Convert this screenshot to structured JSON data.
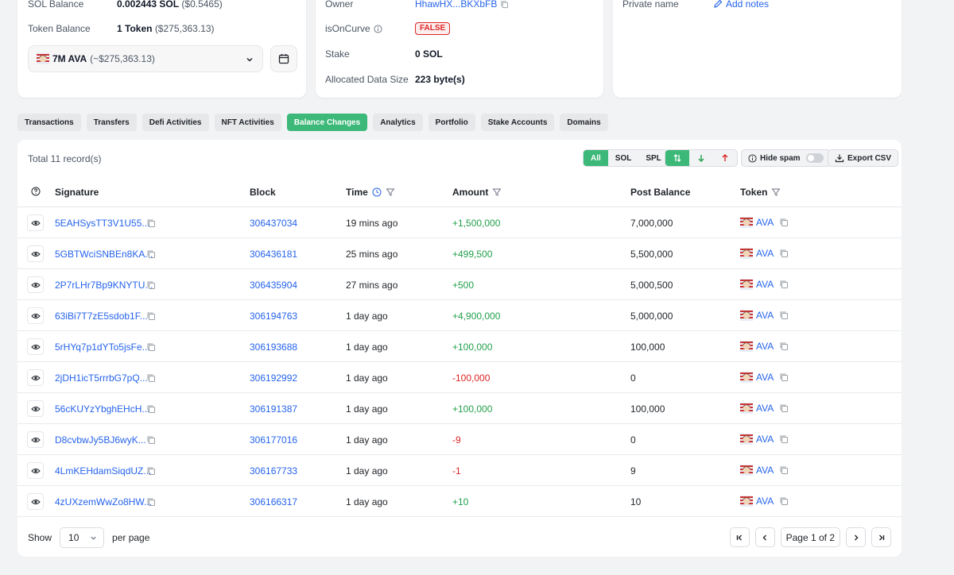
{
  "summary": {
    "sol_balance_label": "SOL Balance",
    "sol_balance_value": "0.002443 SOL",
    "sol_balance_usd": "($0.5465)",
    "token_balance_label": "Token Balance",
    "token_balance_value": "1 Token",
    "token_balance_usd": "($275,363.13)",
    "token_select_amount": "7M AVA",
    "token_select_usd": "(~$275,363.13)"
  },
  "account": {
    "owner_label": "Owner",
    "owner_value": "HhawHX...BKXbFB",
    "is_on_curve_label": "isOnCurve",
    "is_on_curve_value": "FALSE",
    "stake_label": "Stake",
    "stake_value": "0 SOL",
    "alloc_label": "Allocated Data Size",
    "alloc_value": "223 byte(s)"
  },
  "notes": {
    "private_name_label": "Private name",
    "add_notes": "Add notes"
  },
  "tabs": [
    {
      "label": "Transactions"
    },
    {
      "label": "Transfers"
    },
    {
      "label": "Defi Activities"
    },
    {
      "label": "NFT Activities"
    },
    {
      "label": "Balance Changes"
    },
    {
      "label": "Analytics"
    },
    {
      "label": "Portfolio"
    },
    {
      "label": "Stake Accounts"
    },
    {
      "label": "Domains"
    }
  ],
  "active_tab": "Balance Changes",
  "table": {
    "total": "Total 11 record(s)",
    "filters": {
      "all": "All",
      "sol": "SOL",
      "spl": "SPL"
    },
    "hide_spam": "Hide spam",
    "export": "Export CSV",
    "columns": {
      "signature": "Signature",
      "block": "Block",
      "time": "Time",
      "amount": "Amount",
      "post_balance": "Post Balance",
      "token": "Token"
    },
    "rows": [
      {
        "sig": "5EAHSysTT3V1U55...",
        "block": "306437034",
        "time": "19 mins ago",
        "amount": "+1,500,000",
        "balance": "7,000,000",
        "token": "AVA"
      },
      {
        "sig": "5GBTWciSNBEn8KA...",
        "block": "306436181",
        "time": "25 mins ago",
        "amount": "+499,500",
        "balance": "5,500,000",
        "token": "AVA"
      },
      {
        "sig": "2P7rLHr7Bp9KNYTU...",
        "block": "306435904",
        "time": "27 mins ago",
        "amount": "+500",
        "balance": "5,000,500",
        "token": "AVA"
      },
      {
        "sig": "63iBi7T7zE5sdob1F...",
        "block": "306194763",
        "time": "1 day ago",
        "amount": "+4,900,000",
        "balance": "5,000,000",
        "token": "AVA"
      },
      {
        "sig": "5rHYq7p1dYTo5jsFe...",
        "block": "306193688",
        "time": "1 day ago",
        "amount": "+100,000",
        "balance": "100,000",
        "token": "AVA"
      },
      {
        "sig": "2jDH1icT5rrrbG7pQ...",
        "block": "306192992",
        "time": "1 day ago",
        "amount": "-100,000",
        "balance": "0",
        "token": "AVA"
      },
      {
        "sig": "56cKUYzYbghEHcH...",
        "block": "306191387",
        "time": "1 day ago",
        "amount": "+100,000",
        "balance": "100,000",
        "token": "AVA"
      },
      {
        "sig": "D8cvbwJy5BJ6wyK...",
        "block": "306177016",
        "time": "1 day ago",
        "amount": "-9",
        "balance": "0",
        "token": "AVA"
      },
      {
        "sig": "4LmKEHdamSiqdUZ...",
        "block": "306167733",
        "time": "1 day ago",
        "amount": "-1",
        "balance": "9",
        "token": "AVA"
      },
      {
        "sig": "4zUXzemWwZo8HW...",
        "block": "306166317",
        "time": "1 day ago",
        "amount": "+10",
        "balance": "10",
        "token": "AVA"
      }
    ]
  },
  "pagination": {
    "show": "Show",
    "per_page_value": "10",
    "per_page": "per page",
    "page_text": "Page 1 of 2"
  },
  "colors": {
    "accent": "#3cb878",
    "link": "#2563eb",
    "positive": "#22a04b",
    "negative": "#dc2626"
  }
}
